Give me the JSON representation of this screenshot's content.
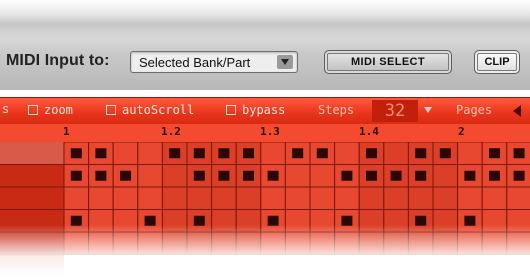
{
  "header": {
    "midi_input_label": "MIDI Input to:",
    "midi_input_value": "Selected Bank/Part",
    "midi_select_label": "MIDI SELECT",
    "clip_label": "CLIP"
  },
  "options": {
    "left_fragment": "s",
    "zoom": "zoom",
    "autoscroll": "autoScroll",
    "bypass": "bypass",
    "steps_label": "Steps",
    "steps_value": "32",
    "pages_label": "Pages"
  },
  "ruler": {
    "markers": [
      "1",
      "1.2",
      "1.3",
      "1.4",
      "2"
    ]
  },
  "grid": {
    "rows": 5,
    "cols": 20,
    "active": [
      [
        1,
        1,
        0,
        0,
        1,
        1,
        1,
        1,
        0,
        1,
        1,
        0,
        1,
        0,
        1,
        1,
        0,
        1,
        1,
        0
      ],
      [
        1,
        1,
        1,
        0,
        0,
        1,
        1,
        1,
        1,
        0,
        0,
        1,
        1,
        1,
        1,
        0,
        1,
        1,
        1,
        1
      ],
      [
        0,
        0,
        0,
        0,
        0,
        0,
        0,
        0,
        0,
        0,
        0,
        0,
        0,
        0,
        0,
        0,
        0,
        0,
        0,
        0
      ],
      [
        1,
        0,
        0,
        1,
        0,
        1,
        0,
        0,
        1,
        0,
        0,
        1,
        0,
        0,
        1,
        0,
        1,
        0,
        0,
        1
      ],
      [
        0,
        0,
        0,
        0,
        0,
        0,
        0,
        0,
        0,
        0,
        0,
        0,
        0,
        0,
        0,
        0,
        0,
        0,
        0,
        0
      ]
    ]
  },
  "colors": {
    "accent": "#e8351c",
    "cell": "#e8482f",
    "cell_alt": "#dc3f27",
    "grid_line": "#7b1608",
    "note": "#2b0804",
    "label_column": "#c82a14"
  }
}
